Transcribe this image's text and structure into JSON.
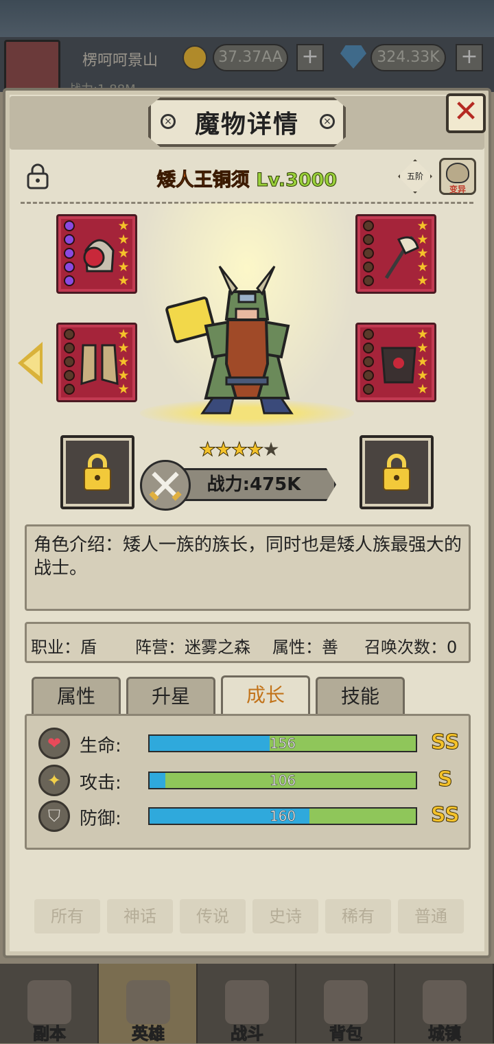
{
  "top_bar": {
    "player_name": "楞呵呵景山",
    "gold": "37.37AA",
    "gems": "324.33K",
    "plus": "+",
    "sub_power": "战力:1.88M"
  },
  "modal": {
    "title": "魔物详情",
    "close": "✕",
    "monster_name": "矮人王铜须",
    "monster_level": "Lv.3000",
    "rank_badge": "五阶",
    "mutate_label": "变异",
    "stars_on": 4,
    "stars_total": 5,
    "power": "战力:475K",
    "description": "角色介绍：矮人一族的族长，同时也是矮人族最强大的战士。",
    "info": {
      "job": "职业：盾",
      "faction": "阵营：迷雾之森",
      "attribute": "属性：善",
      "summon": "召唤次数：0"
    },
    "tabs": [
      "属性",
      "升星",
      "成长",
      "技能"
    ],
    "active_tab": "成长",
    "stats": [
      {
        "label": "生命:",
        "value": "156",
        "fill_pct": 45,
        "grade": "SS"
      },
      {
        "label": "攻击:",
        "value": "106",
        "fill_pct": 6,
        "grade": "S"
      },
      {
        "label": "防御:",
        "value": "160",
        "fill_pct": 60,
        "grade": "SS"
      }
    ]
  },
  "equipment": [
    {
      "slot": "helmet",
      "gems": 5,
      "stars": 5
    },
    {
      "slot": "weapon",
      "gems": 0,
      "stars": 5
    },
    {
      "slot": "boots",
      "gems": 0,
      "stars": 5
    },
    {
      "slot": "armor",
      "gems": 0,
      "stars": 5
    }
  ],
  "background_filters": [
    "所有",
    "神话",
    "传说",
    "史诗",
    "稀有",
    "普通"
  ],
  "bottom_nav": [
    "副本",
    "英雄",
    "战斗",
    "背包",
    "城镇"
  ],
  "colors": {
    "name_orange": "#d9661a",
    "level_green": "#9ad13a",
    "bar_blue": "#2fa9dc",
    "bar_green": "#8fc65a",
    "grade_gold": "#f4c22a",
    "equip_red": "#a5243a"
  }
}
